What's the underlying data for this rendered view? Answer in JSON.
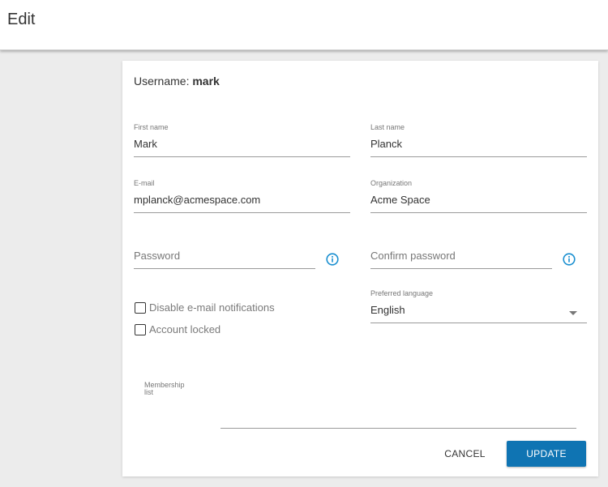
{
  "header": {
    "title": "Edit"
  },
  "form": {
    "username_label": "Username:",
    "username_value": "mark",
    "first_name": {
      "label": "First name",
      "value": "Mark"
    },
    "last_name": {
      "label": "Last name",
      "value": "Planck"
    },
    "email": {
      "label": "E-mail",
      "value": "mplanck@acmespace.com"
    },
    "organization": {
      "label": "Organization",
      "value": "Acme Space"
    },
    "password": {
      "placeholder": "Password"
    },
    "confirm_password": {
      "placeholder": "Confirm password"
    },
    "disable_notifications": {
      "label": "Disable e-mail notifications",
      "checked": false
    },
    "account_locked": {
      "label": "Account locked",
      "checked": false
    },
    "preferred_language": {
      "label": "Preferred language",
      "value": "English"
    },
    "membership_list": {
      "label_line1": "Membership",
      "label_line2": "list"
    }
  },
  "actions": {
    "cancel_label": "CANCEL",
    "update_label": "UPDATE"
  },
  "colors": {
    "accent": "#0f74b3",
    "background": "#ececec",
    "card": "#ffffff"
  },
  "icons": {
    "password_info": "info-icon",
    "confirm_info": "info-icon",
    "language_dropdown": "caret-down-icon"
  }
}
